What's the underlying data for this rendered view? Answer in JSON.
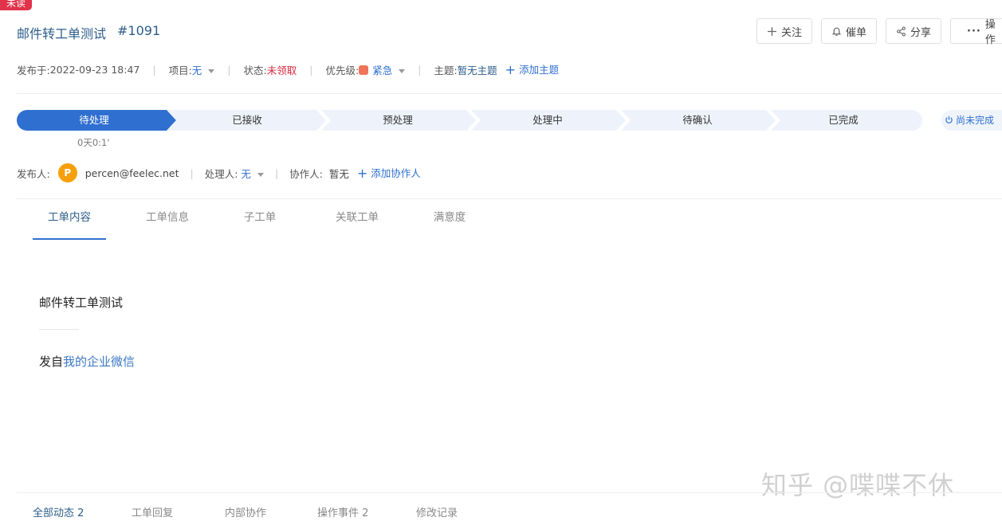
{
  "badge": "未读",
  "header": {
    "title": "邮件转工单测试",
    "ticket_no": "#1091"
  },
  "actions": {
    "follow": "关注",
    "urge": "催单",
    "share": "分享",
    "operate": "操作"
  },
  "meta": {
    "published_label": "发布于:",
    "published_value": "2022-09-23 18:47",
    "project_label": "项目:",
    "project_value": "无",
    "status_label": "状态:",
    "status_value": "未领取",
    "priority_label": "优先级:",
    "priority_value": "紧急",
    "topic_label": "主题:",
    "topic_value": "暂无主题",
    "add_topic": "添加主题"
  },
  "steps": [
    "待处理",
    "已接收",
    "预处理",
    "处理中",
    "待确认",
    "已完成"
  ],
  "step_time": "0天0:1'",
  "pending_label": "尚未完成",
  "people": {
    "publisher_label": "发布人:",
    "avatar_initial": "P",
    "publisher_email": "percen@feelec.net",
    "handler_label": "处理人:",
    "handler_value": "无",
    "collab_label": "协作人:",
    "collab_value": "暂无",
    "add_collab": "添加协作人"
  },
  "tabs": [
    "工单内容",
    "工单信息",
    "子工单",
    "关联工单",
    "满意度"
  ],
  "content": {
    "title": "邮件转工单测试",
    "source_prefix": "发自",
    "source_link": "我的企业微信"
  },
  "bottom_tabs": [
    "全部动态 2",
    "工单回复",
    "内部协作",
    "操作事件 2",
    "修改记录"
  ],
  "watermark": "知乎 @喋喋不休",
  "colors": {
    "accent": "#2f6fd0",
    "danger": "#d7263d",
    "priority": "#f0745a",
    "avatar": "#f5a00a"
  }
}
